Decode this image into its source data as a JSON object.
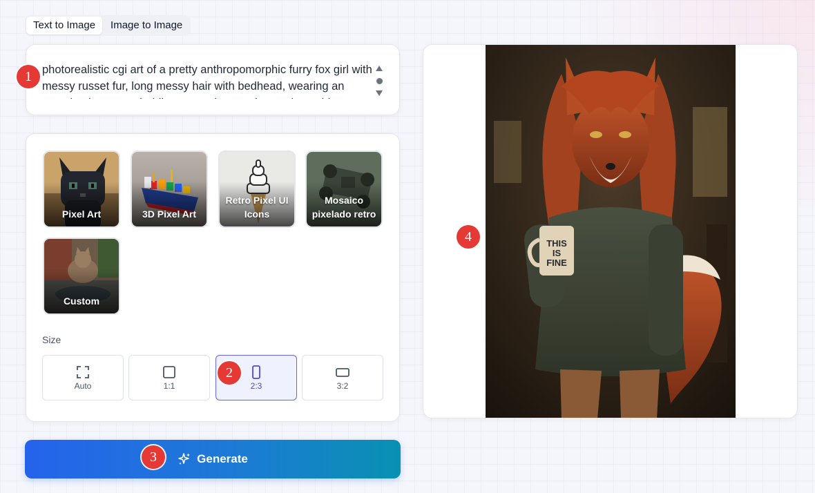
{
  "tabs": [
    {
      "label": "Text to Image",
      "active": true
    },
    {
      "label": "Image to Image",
      "active": false
    }
  ],
  "prompt": {
    "value": "photorealistic cgi art of a pretty anthropomorphic furry fox girl with messy russet fur, long messy hair with bedhead, wearing an oversized sweater, holding a mug in a rustic wooden cabin"
  },
  "styles": [
    {
      "label": "Pixel Art",
      "icon": "pixel-cat-image"
    },
    {
      "label": "3D Pixel Art",
      "icon": "cargo-ship-image"
    },
    {
      "label": "Retro Pixel UI Icons",
      "icon": "ice-cream-cone-image"
    },
    {
      "label": "Mosaico pixelado retro",
      "icon": "race-car-image"
    },
    {
      "label": "Custom",
      "icon": "cat-puddle-image"
    }
  ],
  "size": {
    "title": "Size",
    "options": [
      {
        "label": "Auto",
        "icon": "expand-icon"
      },
      {
        "label": "1:1",
        "icon": "square-icon"
      },
      {
        "label": "2:3",
        "icon": "portrait-icon",
        "selected": true
      },
      {
        "label": "3:2",
        "icon": "landscape-icon"
      }
    ]
  },
  "generate": {
    "label": "Generate",
    "icon": "sparkle-icon"
  },
  "preview": {
    "mug_text": "THIS IS FINE",
    "mug_lines": [
      "THIS",
      "IS",
      "FINE"
    ]
  },
  "markers": [
    "1",
    "2",
    "3",
    "4"
  ],
  "colors": {
    "accent": "#6366f1",
    "generate_start": "#2563eb",
    "generate_end": "#0891b2",
    "marker": "#e53935"
  }
}
